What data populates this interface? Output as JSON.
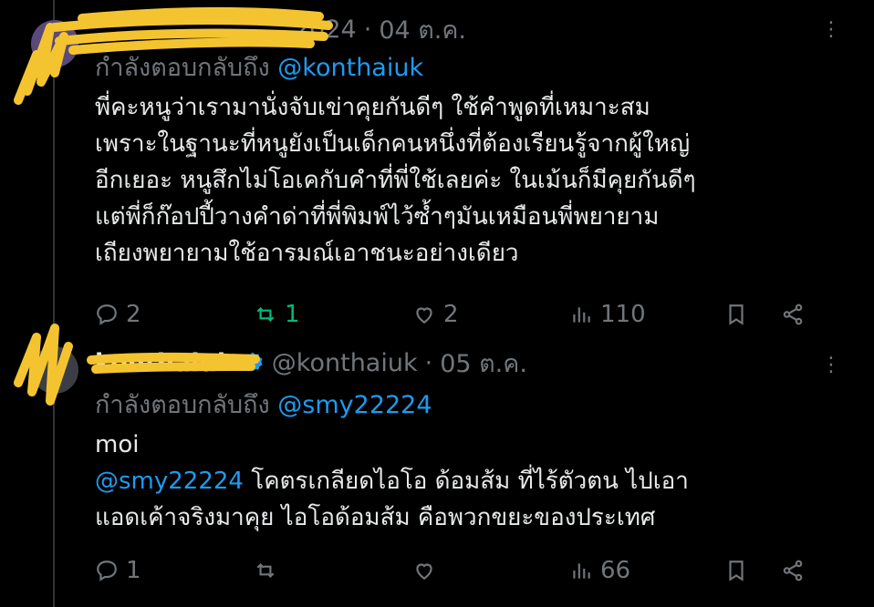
{
  "tweets": [
    {
      "display_name": "",
      "handle": "",
      "date_prefix": "2024",
      "date": "04 ต.ค.",
      "replying_prefix": "กำลังตอบกลับถึง",
      "replying_to": "@konthaiuk",
      "body_lines": [
        "พี่คะหนูว่าเรามานั่งจับเข่าคุยกันดีๆ ใช้คำพูดที่เหมาะสม",
        "เพราะในฐานะที่หนูยังเป็นเด็กคนหนึ่งที่ต้องเรียนรู้จากผู้ใหญ่",
        "อีกเยอะ หนูสึกไม่โอเคกับคำที่พี่ใช้เลยค่ะ ในเม้นก็มีคุยกันดีๆ",
        "แต่พี่ก็ก๊อปปี้วางคำด่าที่พี่พิมพ์ไว้ซ้ำๆมันเหมือนพี่พยายาม",
        "เถียงพยายามใช้อารมณ์เอาชนะอย่างเดียว"
      ],
      "replies": "2",
      "retweets": "1",
      "likes": "2",
      "views": "110"
    },
    {
      "display_name": "konthaiuk",
      "handle": "@konthaiuk",
      "date": "05 ต.ค.",
      "replying_prefix": "กำลังตอบกลับถึง",
      "replying_to": "@smy22224",
      "body_line1": "moi",
      "body_mention": "@smy22224",
      "body_line2_rest": " โคตรเกลียดไอโอ ด้อมส้ม ที่ไร้ตัวตน ไปเอา",
      "body_line3": "แอดเค้าจริงมาคุย ไอโอด้อมส้ม คือพวกขยะของประเทศ",
      "replies": "1",
      "retweets": "",
      "likes": "",
      "views": "66"
    }
  ],
  "colors": {
    "background": "#000000",
    "text": "#e7e9ea",
    "secondary": "#71767b",
    "accent": "#1d9bf0",
    "retweet_active": "#00ba7c",
    "scribble": "#f4c430"
  },
  "icons": [
    "more-icon",
    "reply-icon",
    "retweet-icon",
    "like-icon",
    "views-icon",
    "bookmark-icon",
    "share-icon",
    "verified-icon"
  ]
}
